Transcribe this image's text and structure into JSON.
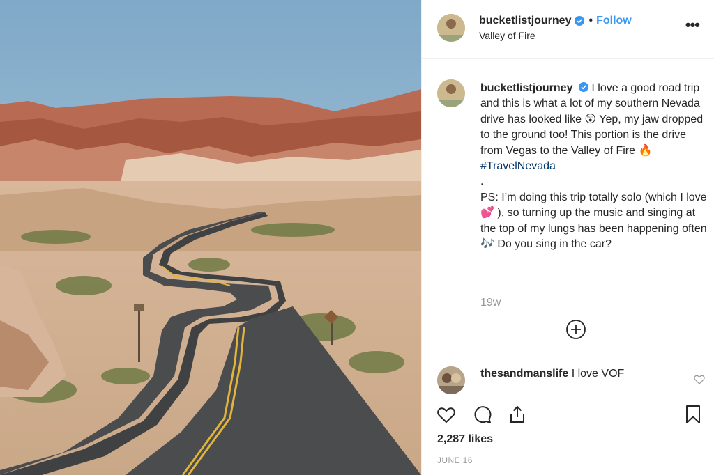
{
  "post": {
    "username": "bucketlistjourney",
    "verified": true,
    "separator": "•",
    "follow_label": "Follow",
    "location": "Valley of Fire",
    "more_icon": "more-options-icon",
    "photo_alt": "Winding desert road through red rock"
  },
  "caption": {
    "username": "bucketlistjourney",
    "text1": " I love a good road trip and this is what a lot of my southern Nevada drive has looked like ",
    "emoji1": "😲",
    "text2": "  Yep, my jaw dropped to the ground too! This portion is the drive from Vegas to the Valley of Fire ",
    "emoji2": "🔥",
    "hashtag": "#TravelNevada",
    "dot_line": ".",
    "ps1": "PS: I’m doing this trip totally solo (which I love ",
    "emoji3": "💕",
    "ps2": " ), so turning up the music and singing at the top of my lungs has been happening often ",
    "emoji4": "🎶",
    "ps3": "  Do you sing in the car?"
  },
  "timestamp": "19w",
  "comments": [
    {
      "username": "thesandmanslife",
      "text": " I love VOF"
    }
  ],
  "footer": {
    "likes": "2,287 likes",
    "date": "JUNE 16"
  },
  "colors": {
    "accent": "#3897f0",
    "hashtag": "#003569",
    "muted": "#999999",
    "text": "#262626"
  }
}
